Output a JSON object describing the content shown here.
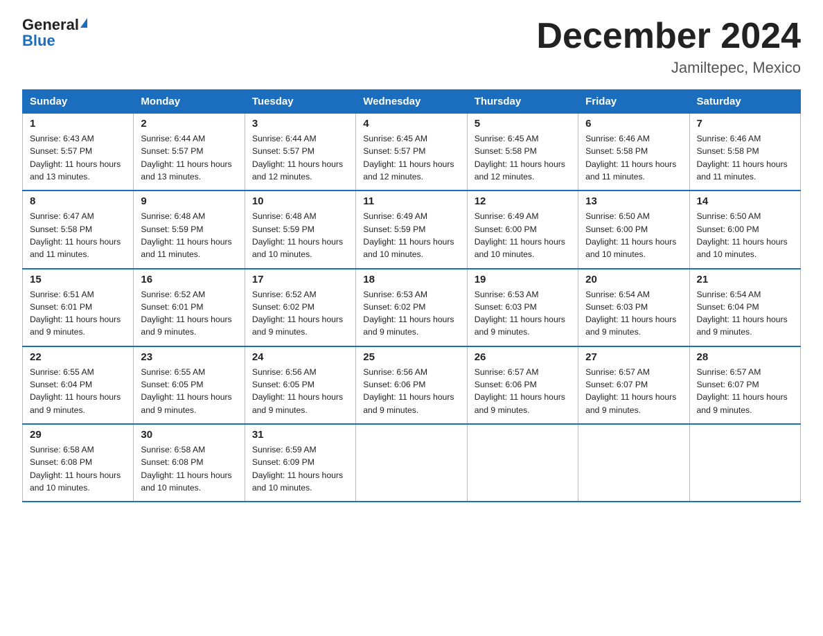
{
  "logo": {
    "general": "General",
    "blue": "Blue"
  },
  "title": "December 2024",
  "subtitle": "Jamiltepec, Mexico",
  "days_of_week": [
    "Sunday",
    "Monday",
    "Tuesday",
    "Wednesday",
    "Thursday",
    "Friday",
    "Saturday"
  ],
  "weeks": [
    [
      {
        "day": "1",
        "sunrise": "6:43 AM",
        "sunset": "5:57 PM",
        "daylight": "11 hours and 13 minutes."
      },
      {
        "day": "2",
        "sunrise": "6:44 AM",
        "sunset": "5:57 PM",
        "daylight": "11 hours and 13 minutes."
      },
      {
        "day": "3",
        "sunrise": "6:44 AM",
        "sunset": "5:57 PM",
        "daylight": "11 hours and 12 minutes."
      },
      {
        "day": "4",
        "sunrise": "6:45 AM",
        "sunset": "5:57 PM",
        "daylight": "11 hours and 12 minutes."
      },
      {
        "day": "5",
        "sunrise": "6:45 AM",
        "sunset": "5:58 PM",
        "daylight": "11 hours and 12 minutes."
      },
      {
        "day": "6",
        "sunrise": "6:46 AM",
        "sunset": "5:58 PM",
        "daylight": "11 hours and 11 minutes."
      },
      {
        "day": "7",
        "sunrise": "6:46 AM",
        "sunset": "5:58 PM",
        "daylight": "11 hours and 11 minutes."
      }
    ],
    [
      {
        "day": "8",
        "sunrise": "6:47 AM",
        "sunset": "5:58 PM",
        "daylight": "11 hours and 11 minutes."
      },
      {
        "day": "9",
        "sunrise": "6:48 AM",
        "sunset": "5:59 PM",
        "daylight": "11 hours and 11 minutes."
      },
      {
        "day": "10",
        "sunrise": "6:48 AM",
        "sunset": "5:59 PM",
        "daylight": "11 hours and 10 minutes."
      },
      {
        "day": "11",
        "sunrise": "6:49 AM",
        "sunset": "5:59 PM",
        "daylight": "11 hours and 10 minutes."
      },
      {
        "day": "12",
        "sunrise": "6:49 AM",
        "sunset": "6:00 PM",
        "daylight": "11 hours and 10 minutes."
      },
      {
        "day": "13",
        "sunrise": "6:50 AM",
        "sunset": "6:00 PM",
        "daylight": "11 hours and 10 minutes."
      },
      {
        "day": "14",
        "sunrise": "6:50 AM",
        "sunset": "6:00 PM",
        "daylight": "11 hours and 10 minutes."
      }
    ],
    [
      {
        "day": "15",
        "sunrise": "6:51 AM",
        "sunset": "6:01 PM",
        "daylight": "11 hours and 9 minutes."
      },
      {
        "day": "16",
        "sunrise": "6:52 AM",
        "sunset": "6:01 PM",
        "daylight": "11 hours and 9 minutes."
      },
      {
        "day": "17",
        "sunrise": "6:52 AM",
        "sunset": "6:02 PM",
        "daylight": "11 hours and 9 minutes."
      },
      {
        "day": "18",
        "sunrise": "6:53 AM",
        "sunset": "6:02 PM",
        "daylight": "11 hours and 9 minutes."
      },
      {
        "day": "19",
        "sunrise": "6:53 AM",
        "sunset": "6:03 PM",
        "daylight": "11 hours and 9 minutes."
      },
      {
        "day": "20",
        "sunrise": "6:54 AM",
        "sunset": "6:03 PM",
        "daylight": "11 hours and 9 minutes."
      },
      {
        "day": "21",
        "sunrise": "6:54 AM",
        "sunset": "6:04 PM",
        "daylight": "11 hours and 9 minutes."
      }
    ],
    [
      {
        "day": "22",
        "sunrise": "6:55 AM",
        "sunset": "6:04 PM",
        "daylight": "11 hours and 9 minutes."
      },
      {
        "day": "23",
        "sunrise": "6:55 AM",
        "sunset": "6:05 PM",
        "daylight": "11 hours and 9 minutes."
      },
      {
        "day": "24",
        "sunrise": "6:56 AM",
        "sunset": "6:05 PM",
        "daylight": "11 hours and 9 minutes."
      },
      {
        "day": "25",
        "sunrise": "6:56 AM",
        "sunset": "6:06 PM",
        "daylight": "11 hours and 9 minutes."
      },
      {
        "day": "26",
        "sunrise": "6:57 AM",
        "sunset": "6:06 PM",
        "daylight": "11 hours and 9 minutes."
      },
      {
        "day": "27",
        "sunrise": "6:57 AM",
        "sunset": "6:07 PM",
        "daylight": "11 hours and 9 minutes."
      },
      {
        "day": "28",
        "sunrise": "6:57 AM",
        "sunset": "6:07 PM",
        "daylight": "11 hours and 9 minutes."
      }
    ],
    [
      {
        "day": "29",
        "sunrise": "6:58 AM",
        "sunset": "6:08 PM",
        "daylight": "11 hours and 10 minutes."
      },
      {
        "day": "30",
        "sunrise": "6:58 AM",
        "sunset": "6:08 PM",
        "daylight": "11 hours and 10 minutes."
      },
      {
        "day": "31",
        "sunrise": "6:59 AM",
        "sunset": "6:09 PM",
        "daylight": "11 hours and 10 minutes."
      },
      null,
      null,
      null,
      null
    ]
  ],
  "labels": {
    "sunrise": "Sunrise:",
    "sunset": "Sunset:",
    "daylight": "Daylight:"
  }
}
